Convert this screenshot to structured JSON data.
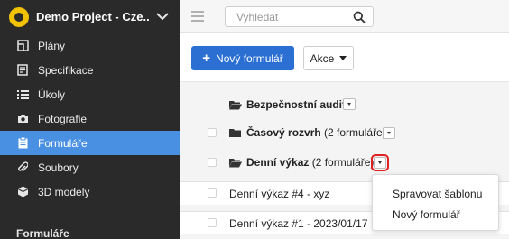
{
  "project": {
    "name": "Demo Project - Cze..."
  },
  "sidebar": {
    "items": [
      {
        "label": "Plány",
        "icon": "map-icon"
      },
      {
        "label": "Specifikace",
        "icon": "document-icon"
      },
      {
        "label": "Úkoly",
        "icon": "list-icon"
      },
      {
        "label": "Fotografie",
        "icon": "camera-icon"
      },
      {
        "label": "Formuláře",
        "icon": "clipboard-icon",
        "active": true
      },
      {
        "label": "Soubory",
        "icon": "paperclip-icon"
      },
      {
        "label": "3D modely",
        "icon": "cube-icon"
      }
    ],
    "section_title": "Formuláře"
  },
  "search": {
    "placeholder": "Vyhledat"
  },
  "toolbar": {
    "new_form_label": "Nový formulář",
    "actions_label": "Akce"
  },
  "folders": [
    {
      "name": "Bezpečnostní audit",
      "count": ""
    },
    {
      "name": "Časový rozvrh",
      "count": "(2 formuláře)"
    },
    {
      "name": "Denní výkaz",
      "count": "(2 formuláře)"
    }
  ],
  "forms": [
    {
      "title": "Denní výkaz #4 - xyz"
    },
    {
      "title": "Denní výkaz #1 - 2023/01/17"
    }
  ],
  "menu": {
    "items": [
      {
        "label": "Spravovat šablonu"
      },
      {
        "label": "Nový formulář"
      }
    ]
  },
  "colors": {
    "sidebar_bg": "#2a2a2a",
    "accent": "#4a90e2",
    "primary_button": "#2b6fd3",
    "highlight": "#e02020"
  }
}
